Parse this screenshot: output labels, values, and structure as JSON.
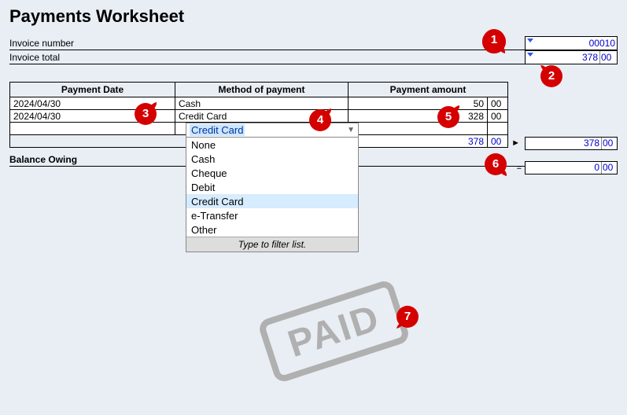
{
  "title": "Payments Worksheet",
  "header": {
    "invoice_number_label": "Invoice number",
    "invoice_number_value": "00010",
    "invoice_total_label": "Invoice total",
    "invoice_total_main": "378",
    "invoice_total_cents": "00"
  },
  "columns": {
    "date": "Payment Date",
    "method": "Method of payment",
    "amount": "Payment amount"
  },
  "rows": [
    {
      "date": "2024/04/30",
      "method": "Cash",
      "amount_main": "50",
      "amount_cents": "00"
    },
    {
      "date": "2024/04/30",
      "method": "Credit Card",
      "amount_main": "328",
      "amount_cents": "00"
    }
  ],
  "totals": {
    "sum_main": "378",
    "sum_cents": "00",
    "side_sum_main": "378",
    "side_sum_cents": "00"
  },
  "balance": {
    "label": "Balance Owing",
    "main": "0",
    "cents": "00"
  },
  "dropdown": {
    "selected": "Credit Card",
    "options": [
      "None",
      "Cash",
      "Cheque",
      "Debit",
      "Credit Card",
      "e-Transfer",
      "Other"
    ],
    "highlight_index": 4,
    "filter_hint": "Type to filter list."
  },
  "callouts": [
    "1",
    "2",
    "3",
    "4",
    "5",
    "6",
    "7"
  ],
  "stamp": "PAID"
}
